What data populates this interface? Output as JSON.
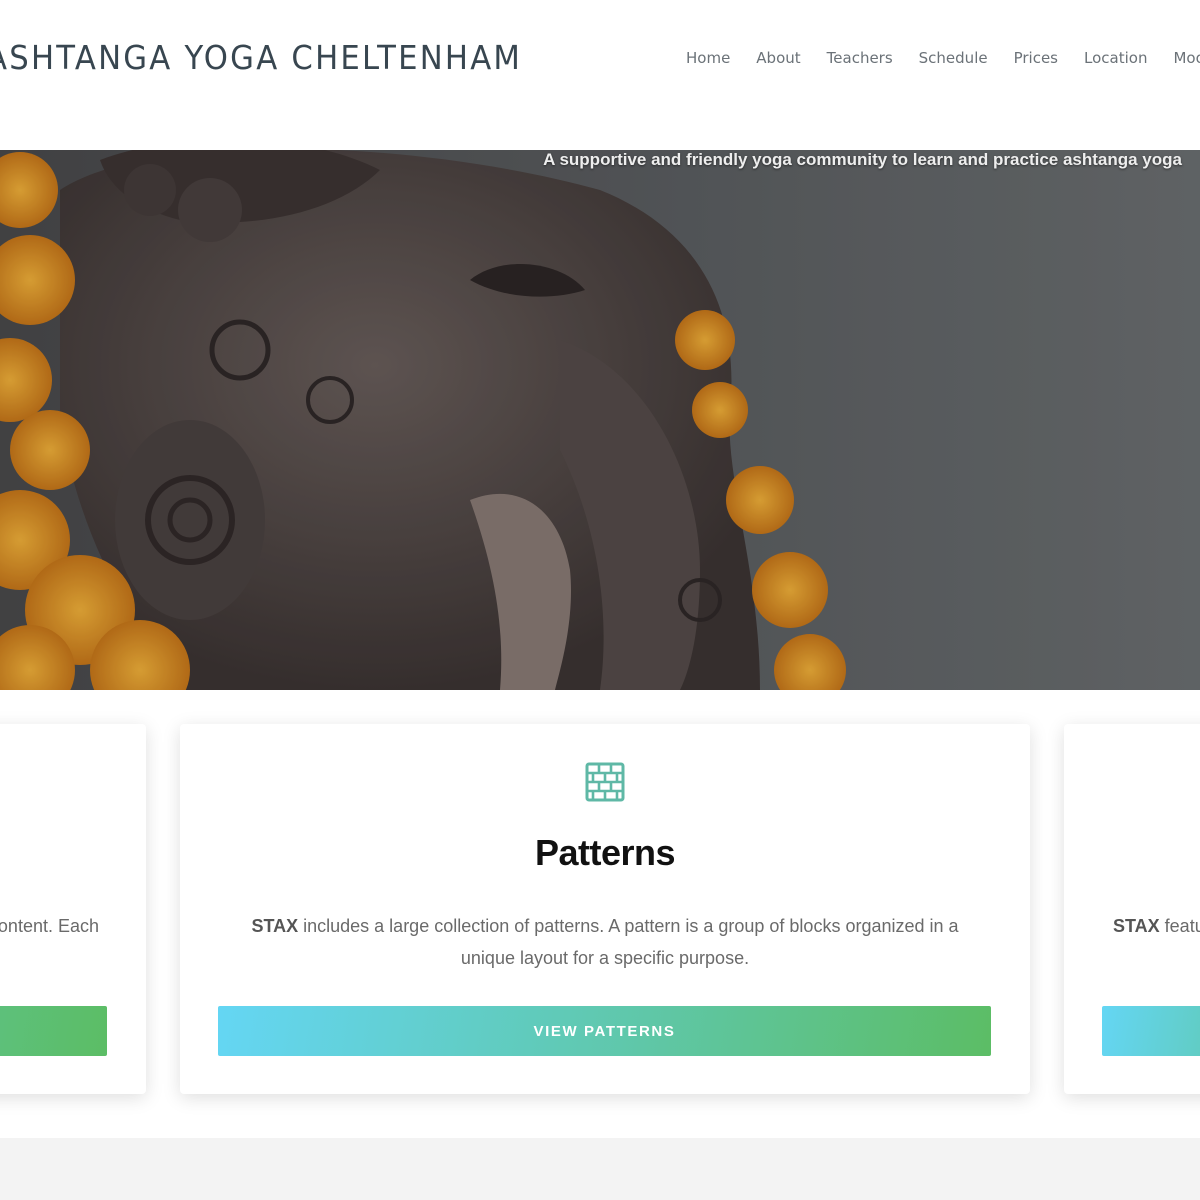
{
  "header": {
    "site_title": "ASHTANGA YOGA CHELTENHAM",
    "nav": [
      "Home",
      "About",
      "Teachers",
      "Schedule",
      "Prices",
      "Location",
      "Moon d"
    ]
  },
  "hero": {
    "tagline": "A supportive and friendly yoga community to learn and practice ashtanga yoga",
    "image_subject": "stone Ganesha statue with orange marigold garlands"
  },
  "cards": {
    "left": {
      "text_fragment": "ontent. Each"
    },
    "center": {
      "icon": "brick-wall-icon",
      "title": "Patterns",
      "brand": "STAX",
      "text": " includes a large collection of patterns. A pattern is a group of blocks organized in a unique layout for a specific purpose.",
      "button": "VIEW PATTERNS"
    },
    "right": {
      "brand": "STAX",
      "text_fragment": " featu"
    }
  },
  "colors": {
    "accent_teal": "#5fc7a8",
    "gradient_start": "#64d6f4",
    "gradient_end": "#5cbd65",
    "title_text": "#384650"
  }
}
